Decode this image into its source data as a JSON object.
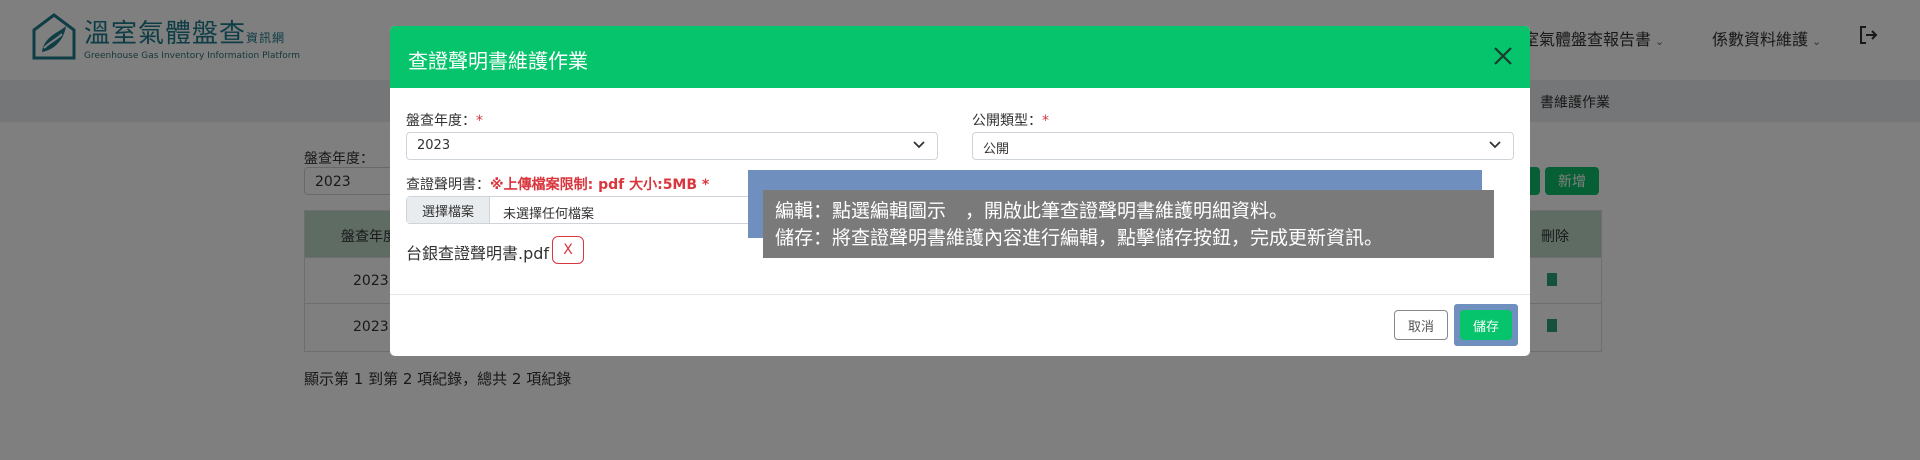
{
  "header": {
    "logo_title": "溫室氣體盤查",
    "logo_title_suffix": "資訊網",
    "logo_subtitle": "Greenhouse Gas Inventory Information Platform",
    "nav": [
      {
        "label": "溫室氣體盤查報告書"
      },
      {
        "label": "係數資料維護"
      }
    ]
  },
  "subbar": {
    "breadcrumb": "書維護作業"
  },
  "background": {
    "year_label": "盤查年度：",
    "year_value": "2023",
    "add_button": "新增",
    "table": {
      "header_year": "盤查年度",
      "header_delete": "刪除",
      "rows": [
        {
          "year": "2023"
        },
        {
          "year": "2023"
        }
      ]
    },
    "footer": "顯示第 1 到第 2 項紀錄，總共 2 項紀錄"
  },
  "modal": {
    "title": "查證聲明書維護作業",
    "year_label": "盤查年度：",
    "year_value": "2023",
    "type_label": "公開類型：",
    "type_value": "公開",
    "required_mark": "*",
    "cert_label": "查證聲明書：",
    "cert_hint": "※上傳檔案限制: pdf 大小:5MB *",
    "file_button": "選擇檔案",
    "file_none": "未選擇任何檔案",
    "uploaded_file": "台銀查證聲明書.pdf",
    "delete_file": "X",
    "cancel": "取消",
    "save": "儲存"
  },
  "tooltip": {
    "line1": "編輯：點選編輯圖示　，開啟此筆查證聲明書維護明細資料。",
    "line2": "儲存：將查證聲明書維護內容進行編輯，點擊儲存按鈕，完成更新資訊。"
  },
  "colors": {
    "accent": "#05c46b",
    "highlight": "#6f8fbe",
    "required": "#d9363e"
  }
}
